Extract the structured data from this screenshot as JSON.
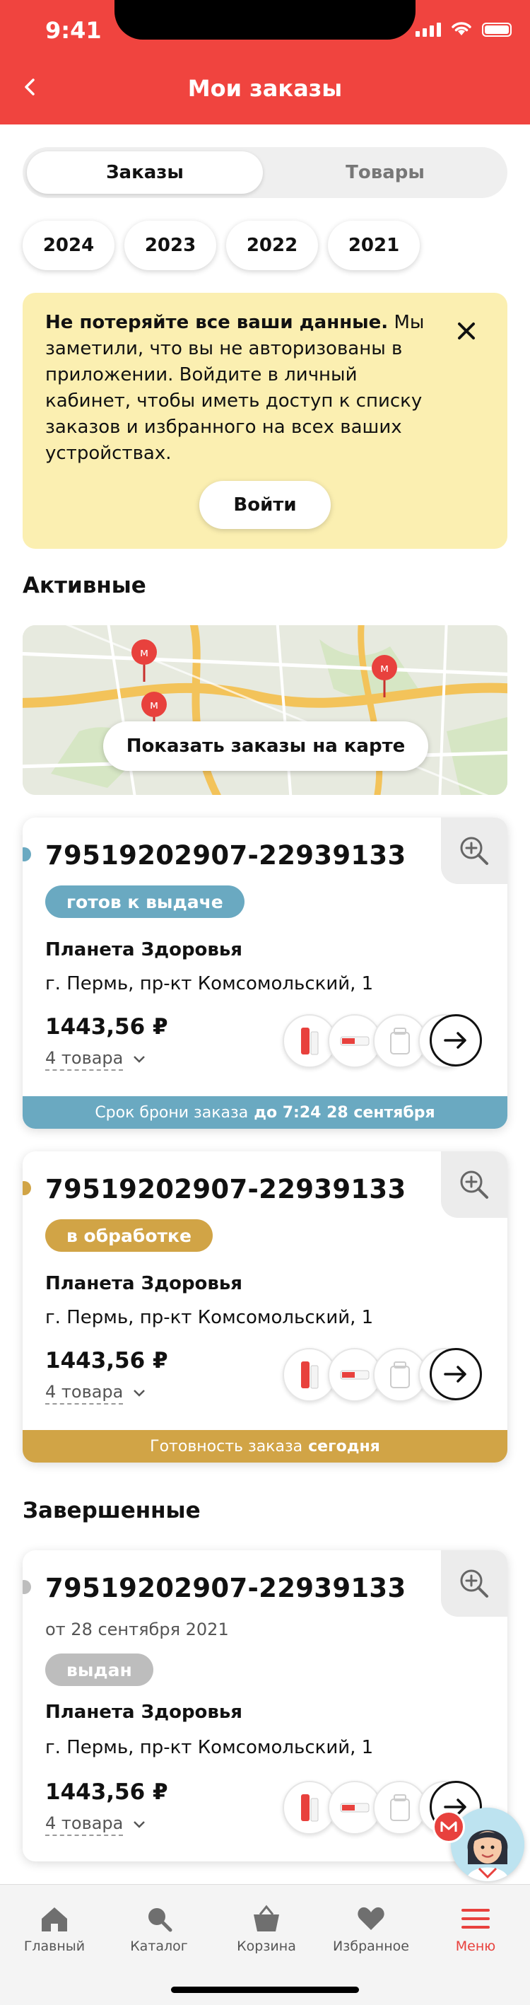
{
  "status": {
    "time": "9:41"
  },
  "header": {
    "title": "Мои заказы"
  },
  "segment": {
    "active": "Заказы",
    "inactive": "Товары"
  },
  "years": [
    "2024",
    "2023",
    "2022",
    "2021"
  ],
  "notice": {
    "bold": "Не потеряйте все ваши данные.",
    "text": " Мы заметили, что вы не авторизованы в приложении. Войдите в личный кабинет, чтобы иметь доступ к списку заказов и избранного на всех ваших устройствах.",
    "login_label": "Войти"
  },
  "sections": {
    "active": "Активные",
    "completed": "Завершенные"
  },
  "map": {
    "button_label": "Показать заказы на карте"
  },
  "orders": [
    {
      "number": "79519202907-22939133",
      "status": "готов к выдаче",
      "status_color": "#6aa9c1",
      "store": "Планета Здоровья",
      "address": "г. Пермь, пр-кт Комсомольский, 1",
      "price": "1443,56 ₽",
      "count": "4 товара",
      "footer_text": "Срок брони заказа",
      "footer_bold": "до 7:24 28 сентября",
      "footer_color": "#6aa9c1"
    },
    {
      "number": "79519202907-22939133",
      "status": "в обработке",
      "status_color": "#d1a446",
      "store": "Планета Здоровья",
      "address": "г. Пермь, пр-кт Комсомольский, 1",
      "price": "1443,56 ₽",
      "count": "4 товара",
      "footer_text": "Готовность заказа",
      "footer_bold": "сегодня",
      "footer_color": "#d1a446"
    },
    {
      "number": "79519202907-22939133",
      "date": "от 28 сентября 2021",
      "status": "выдан",
      "status_color": "#bdbdbd",
      "store": "Планета Здоровья",
      "address": "г. Пермь, пр-кт Комсомольский, 1",
      "price": "1443,56 ₽",
      "count": "4 товара"
    }
  ],
  "tabbar": [
    "Главный",
    "Каталог",
    "Корзина",
    "Избранное",
    "Меню"
  ],
  "colors": {
    "brand": "#f0443f",
    "active_tab": "#e8413d",
    "notice_bg": "#fbefb1"
  }
}
